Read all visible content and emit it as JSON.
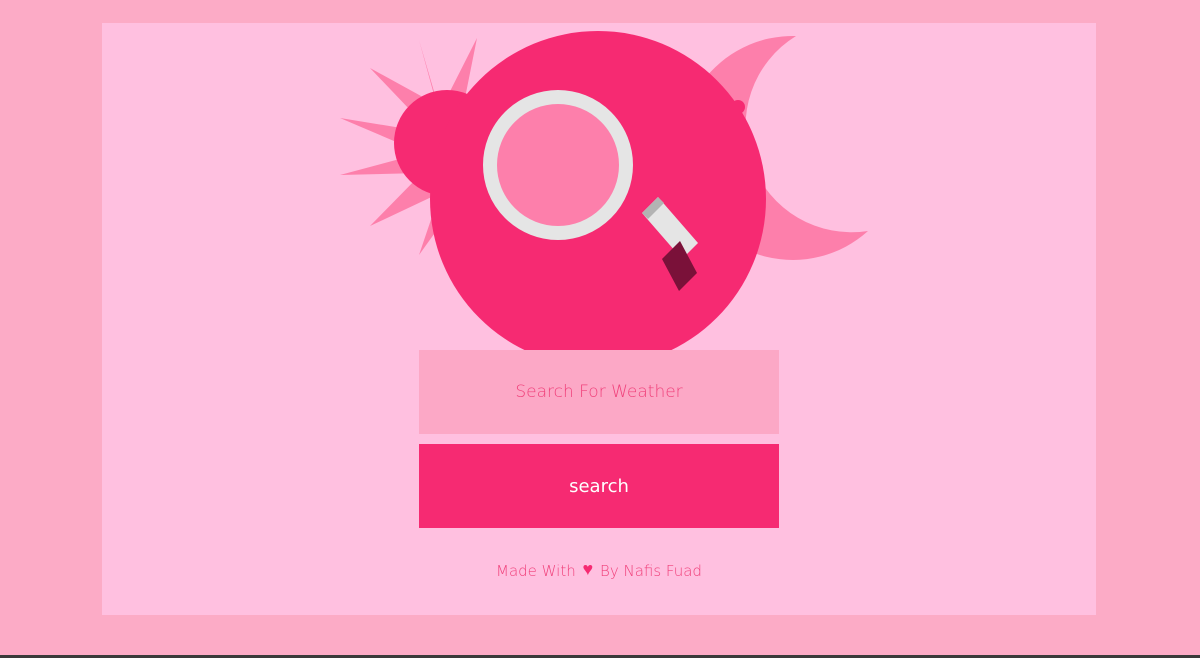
{
  "search": {
    "placeholder": "Search For Weather",
    "value": ""
  },
  "actions": {
    "search_label": "search"
  },
  "footer": {
    "prefix": "Made With",
    "heart_icon": "♥",
    "suffix": "By Nafis Fuad"
  },
  "illustration": {
    "icons": [
      "sun-icon",
      "globe-icon",
      "magnifying-glass-icon",
      "moon-icon"
    ]
  },
  "colors": {
    "page_background": "#fcabc6",
    "card_background": "#ffc0e0",
    "accent": "#f62a72",
    "light_accent": "#fd7fab",
    "input_background": "#fca8c6"
  }
}
